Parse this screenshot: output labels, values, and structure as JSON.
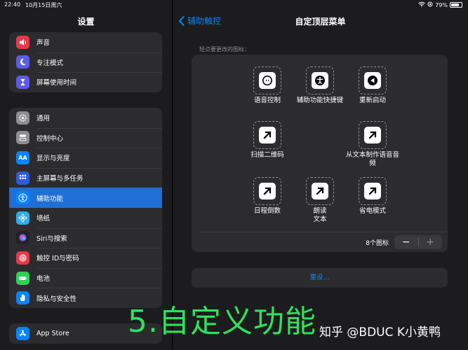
{
  "status": {
    "time": "22:40",
    "date": "10月15日周六",
    "battery": "79%",
    "battery_level": 0.79
  },
  "sidebar": {
    "title": "设置",
    "group1": [
      {
        "label": "声音",
        "icon": "speaker-icon",
        "color": "#e5394b"
      },
      {
        "label": "专注模式",
        "icon": "moon-icon",
        "color": "#5e5ce6"
      },
      {
        "label": "屏幕使用时间",
        "icon": "hourglass-icon",
        "color": "#5e5ce6"
      }
    ],
    "group2": [
      {
        "label": "通用",
        "icon": "gear-icon",
        "color": "#8e8e93"
      },
      {
        "label": "控制中心",
        "icon": "toggles-icon",
        "color": "#8e8e93"
      },
      {
        "label": "显示与亮度",
        "icon": "text-size-icon",
        "color": "#0a84ff",
        "glyph": "AA"
      },
      {
        "label": "主屏幕与多任务",
        "icon": "grid-icon",
        "color": "#2f5bd8"
      },
      {
        "label": "辅助功能",
        "icon": "accessibility-icon",
        "color": "#0a84ff",
        "selected": true
      },
      {
        "label": "墙纸",
        "icon": "flower-icon",
        "color": "#32ade6"
      },
      {
        "label": "Siri与搜索",
        "icon": "siri-icon",
        "color": "#222"
      },
      {
        "label": "触控 ID与密码",
        "icon": "fingerprint-icon",
        "color": "#e5394b"
      },
      {
        "label": "电池",
        "icon": "battery-icon",
        "color": "#30d158"
      },
      {
        "label": "隐私与安全性",
        "icon": "hand-icon",
        "color": "#0a84ff"
      }
    ],
    "group3": [
      {
        "label": "App Store",
        "icon": "app-store-icon",
        "color": "#0a84ff"
      }
    ]
  },
  "main": {
    "back_label": "辅助触控",
    "title": "自定顶层菜单",
    "hint": "轻点要更改的图标：",
    "items": [
      {
        "label": "语音控制",
        "icon": "voice-control-icon"
      },
      {
        "label": "辅助功能快捷键",
        "icon": "accessibility-shortcut-icon"
      },
      {
        "label": "重新启动",
        "icon": "restart-icon"
      },
      {
        "label": "扫描二维码",
        "icon": "arrow-icon"
      },
      {
        "label": "从文本制作语音音频",
        "icon": "arrow-icon"
      },
      {
        "label": "日程倒数",
        "icon": "arrow-icon"
      },
      {
        "label": "朗读文本",
        "icon": "arrow-icon"
      },
      {
        "label": "省电模式",
        "icon": "arrow-icon"
      }
    ],
    "count_label": "8个图标",
    "minus": "−",
    "plus": "+",
    "reset": "重设..."
  },
  "overlay": {
    "caption": "5.自定义功能",
    "watermark": "知乎 @BDUC K小黄鸭"
  }
}
